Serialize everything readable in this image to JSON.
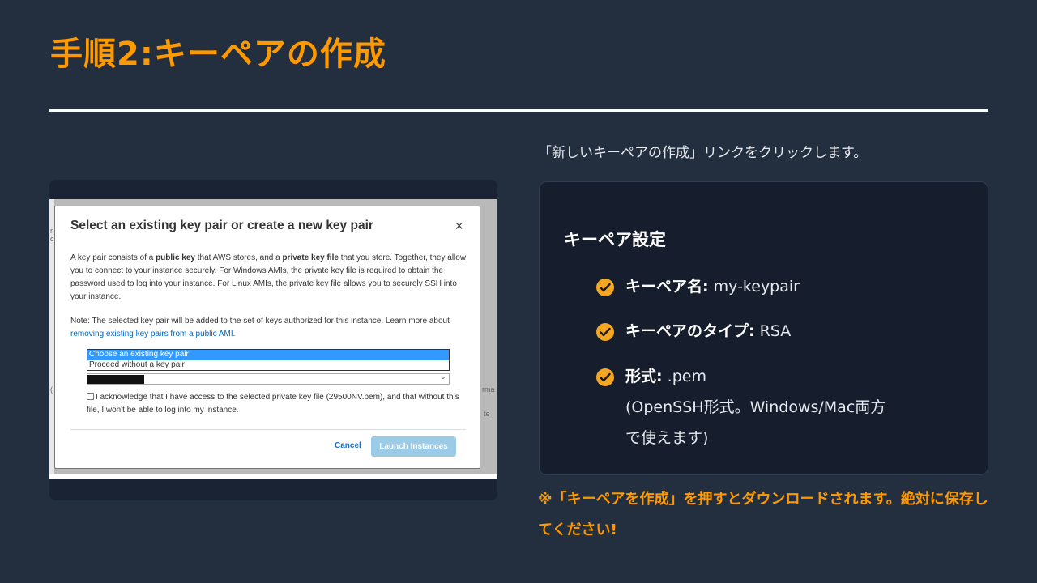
{
  "slide": {
    "title": "手順2:キーペアの作成",
    "intro": "「新しいキーペアの作成」リンクをクリックします。",
    "note": "※「キーペアを作成」を押すとダウンロードされます。絶対に保存してください!"
  },
  "card": {
    "title": "キーペア設定",
    "items": [
      {
        "key": "キーペア名:",
        "value": " my-keypair"
      },
      {
        "key": "キーペアのタイプ:",
        "value": " RSA"
      },
      {
        "key": "形式:",
        "value": " .pem",
        "detail": "(OpenSSH形式。Windows/Mac両方で使えます)"
      }
    ],
    "icon": "check-circle-icon"
  },
  "modal": {
    "title": "Select an existing key pair or create a new key pair",
    "close_glyph": "×",
    "para1_a": "A key pair consists of a ",
    "para1_b": "public key",
    "para1_c": " that AWS stores, and a ",
    "para1_d": "private key file",
    "para1_e": " that you store. Together, they allow you to connect to your instance securely. For Windows AMIs, the private key file is required to obtain the password used to log into your instance. For Linux AMIs, the private key file allows you to securely SSH into your instance.",
    "note_text": "Note: The selected key pair will be added to the set of keys authorized for this instance. Learn more about ",
    "note_link": "removing existing key pairs from a public AMI",
    "note_end": ".",
    "options": [
      "Choose an existing key pair",
      "Proceed without a key pair"
    ],
    "ack": "I acknowledge that I have access to the selected private key file (29500NV.pem), and that without this file, I won't be able to log into my instance.",
    "cancel": "Cancel",
    "launch": "Launch Instances",
    "edge_left_1": "r",
    "edge_left_2": "c",
    "edge_left_3": "(",
    "edge_right_1": "rma",
    "edge_right_2": "te"
  },
  "colors": {
    "accent": "#ff9900",
    "background": "#232f3e",
    "card": "#161e2e",
    "check": "#f5a623"
  }
}
